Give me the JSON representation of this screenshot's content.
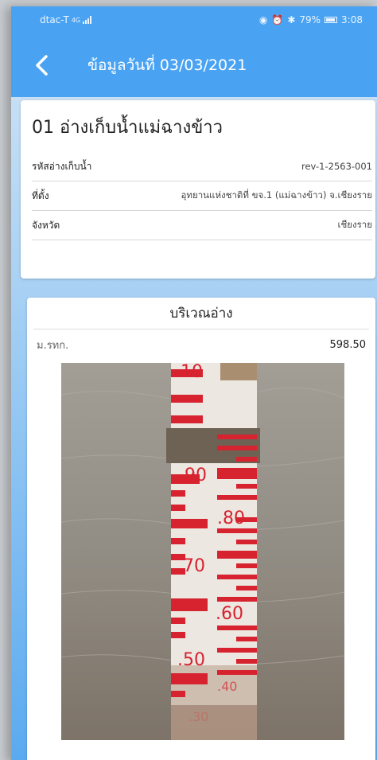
{
  "status_bar": {
    "carrier": "dtac-T",
    "network": "4G",
    "battery": "79%",
    "time": "3:08"
  },
  "app_bar": {
    "title": "ข้อมูลวันที่ 03/03/2021",
    "back_icon": "chevron-left-icon"
  },
  "reservoir": {
    "title": "01 อ่างเก็บน้ำแม่ฉางข้าว",
    "rows": [
      {
        "label": "รหัสอ่างเก็บน้ำ",
        "value": "rev-1-2563-001"
      },
      {
        "label": "ที่ตั้ง",
        "value": "อุทยานแห่งชาติที่ ขจ.1 (แม่ฉางข้าว) จ.เชียงราย"
      },
      {
        "label": "จังหวัด",
        "value": "เชียงราย"
      }
    ]
  },
  "area": {
    "title": "บริเวณอ่าง",
    "level_label": "ม.รทก.",
    "level_value": "598.50",
    "gauge_labels": [
      "10",
      ".90",
      ".80",
      ".70",
      ".60",
      ".50",
      ".40",
      ".30"
    ]
  },
  "colors": {
    "primary": "#4aa3f2",
    "gauge_red": "#d7222f",
    "water": "#9a958b"
  }
}
